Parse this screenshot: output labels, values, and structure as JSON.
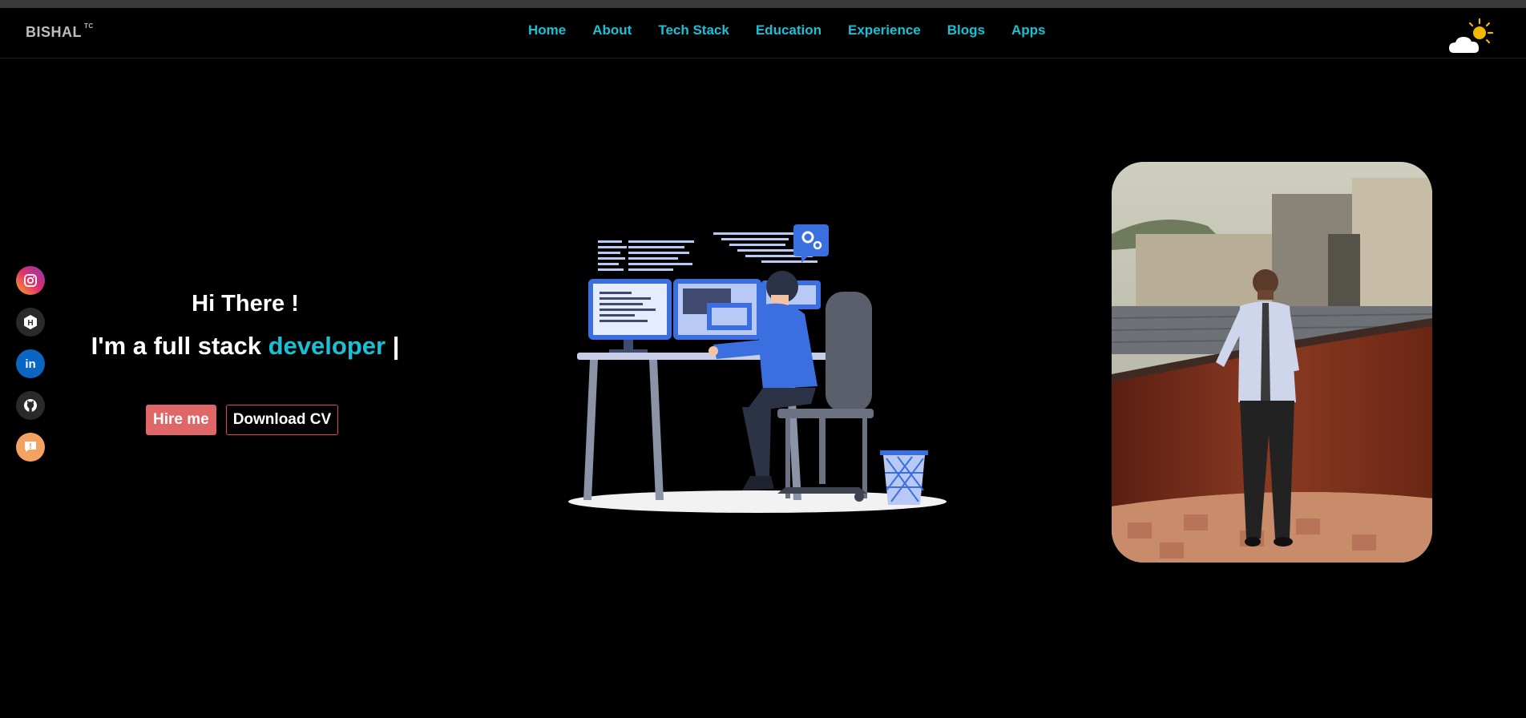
{
  "navbar": {
    "brand": "BISHAL",
    "brand_superscript": "TC",
    "links": [
      "Home",
      "About",
      "Tech Stack",
      "Education",
      "Experience",
      "Blogs",
      "Apps"
    ],
    "weather_icon": "partly-sunny-icon"
  },
  "socials": [
    {
      "name": "instagram",
      "icon": "instagram-icon",
      "color": "#e1306c"
    },
    {
      "name": "hashnode",
      "icon": "hashnode-icon",
      "color": "#2a2a2a"
    },
    {
      "name": "linkedin",
      "icon": "linkedin-icon",
      "color": "#0a66c2"
    },
    {
      "name": "github",
      "icon": "github-icon",
      "color": "#2a2a2a"
    },
    {
      "name": "feedback",
      "icon": "feedback-icon",
      "color": "#f4a261"
    }
  ],
  "hero": {
    "greeting": "Hi There !",
    "role_prefix": "I'm a full stack",
    "role_accent": "developer",
    "cursor": "|",
    "hire_button": "Hire me",
    "cv_button": "Download CV"
  },
  "colors": {
    "accent": "#17c1d6",
    "hire_button": "#e06767",
    "background": "#000000"
  }
}
